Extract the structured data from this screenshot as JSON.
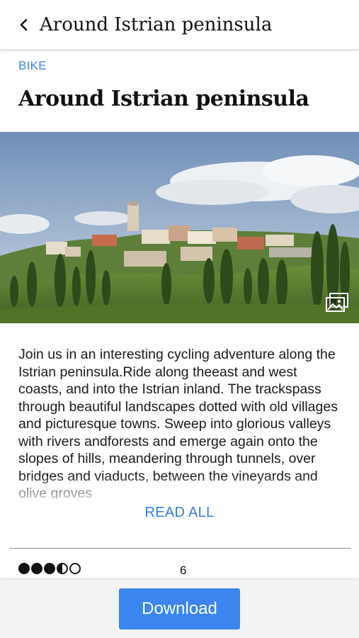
{
  "appbar": {
    "title": "Around Istrian peninsula",
    "back_icon": "chevron-left-icon"
  },
  "article": {
    "category": "BIKE",
    "title": "Around Istrian peninsula",
    "description": "Join us in an interesting cycling adventure along the Istrian peninsula.Ride along theeast and west coasts, and into the Istrian inland. The trackspass through beautiful landscapes dotted with old villages and picturesque towns. Sweep into glorious valleys with rivers andforests and emerge again onto the slopes of hills, meandering through tunnels, over bridges and viaducts, between the vineyards and olive groves",
    "read_all_label": "READ ALL",
    "gallery_icon": "image-gallery-icon"
  },
  "rating": {
    "value": 3.5,
    "max": 5,
    "count": "6"
  },
  "actions": {
    "download_label": "Download"
  },
  "colors": {
    "accent": "#3a86ee",
    "text": "#111111"
  }
}
